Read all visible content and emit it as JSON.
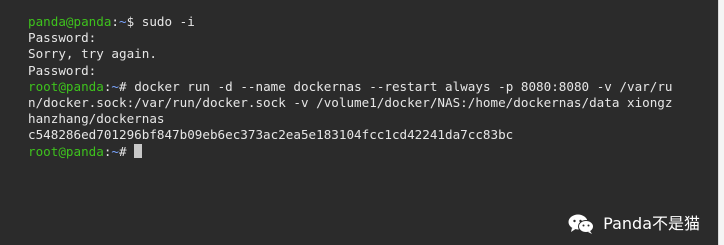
{
  "terminal": {
    "lines": [
      {
        "user": "panda@panda",
        "path": "~",
        "symbol": "$ ",
        "cmd": "sudo -i"
      },
      {
        "text": "Password:"
      },
      {
        "text": "Sorry, try again."
      },
      {
        "text": "Password:"
      },
      {
        "user": "root@panda",
        "path": "~",
        "symbol": "# ",
        "cmd": "docker run -d --name dockernas --restart always -p 8080:8080 -v /var/ru"
      },
      {
        "text": "n/docker.sock:/var/run/docker.sock -v /volume1/docker/NAS:/home/dockernas/data xiongz"
      },
      {
        "text": "hanzhang/dockernas"
      },
      {
        "text": "c548286ed701296bf847b09eb6ec373ac2ea5e183104fcc1cd42241da7cc83bc"
      },
      {
        "user": "root@panda",
        "path": "~",
        "symbol": "# ",
        "cmd": ""
      }
    ]
  },
  "watermark": {
    "text": "Panda不是猫",
    "icon": "wechat-icon"
  },
  "colors": {
    "background": "#2b2b2b",
    "text": "#e6e6e6",
    "user": "#3ec21d",
    "path": "#7aa5ff"
  }
}
